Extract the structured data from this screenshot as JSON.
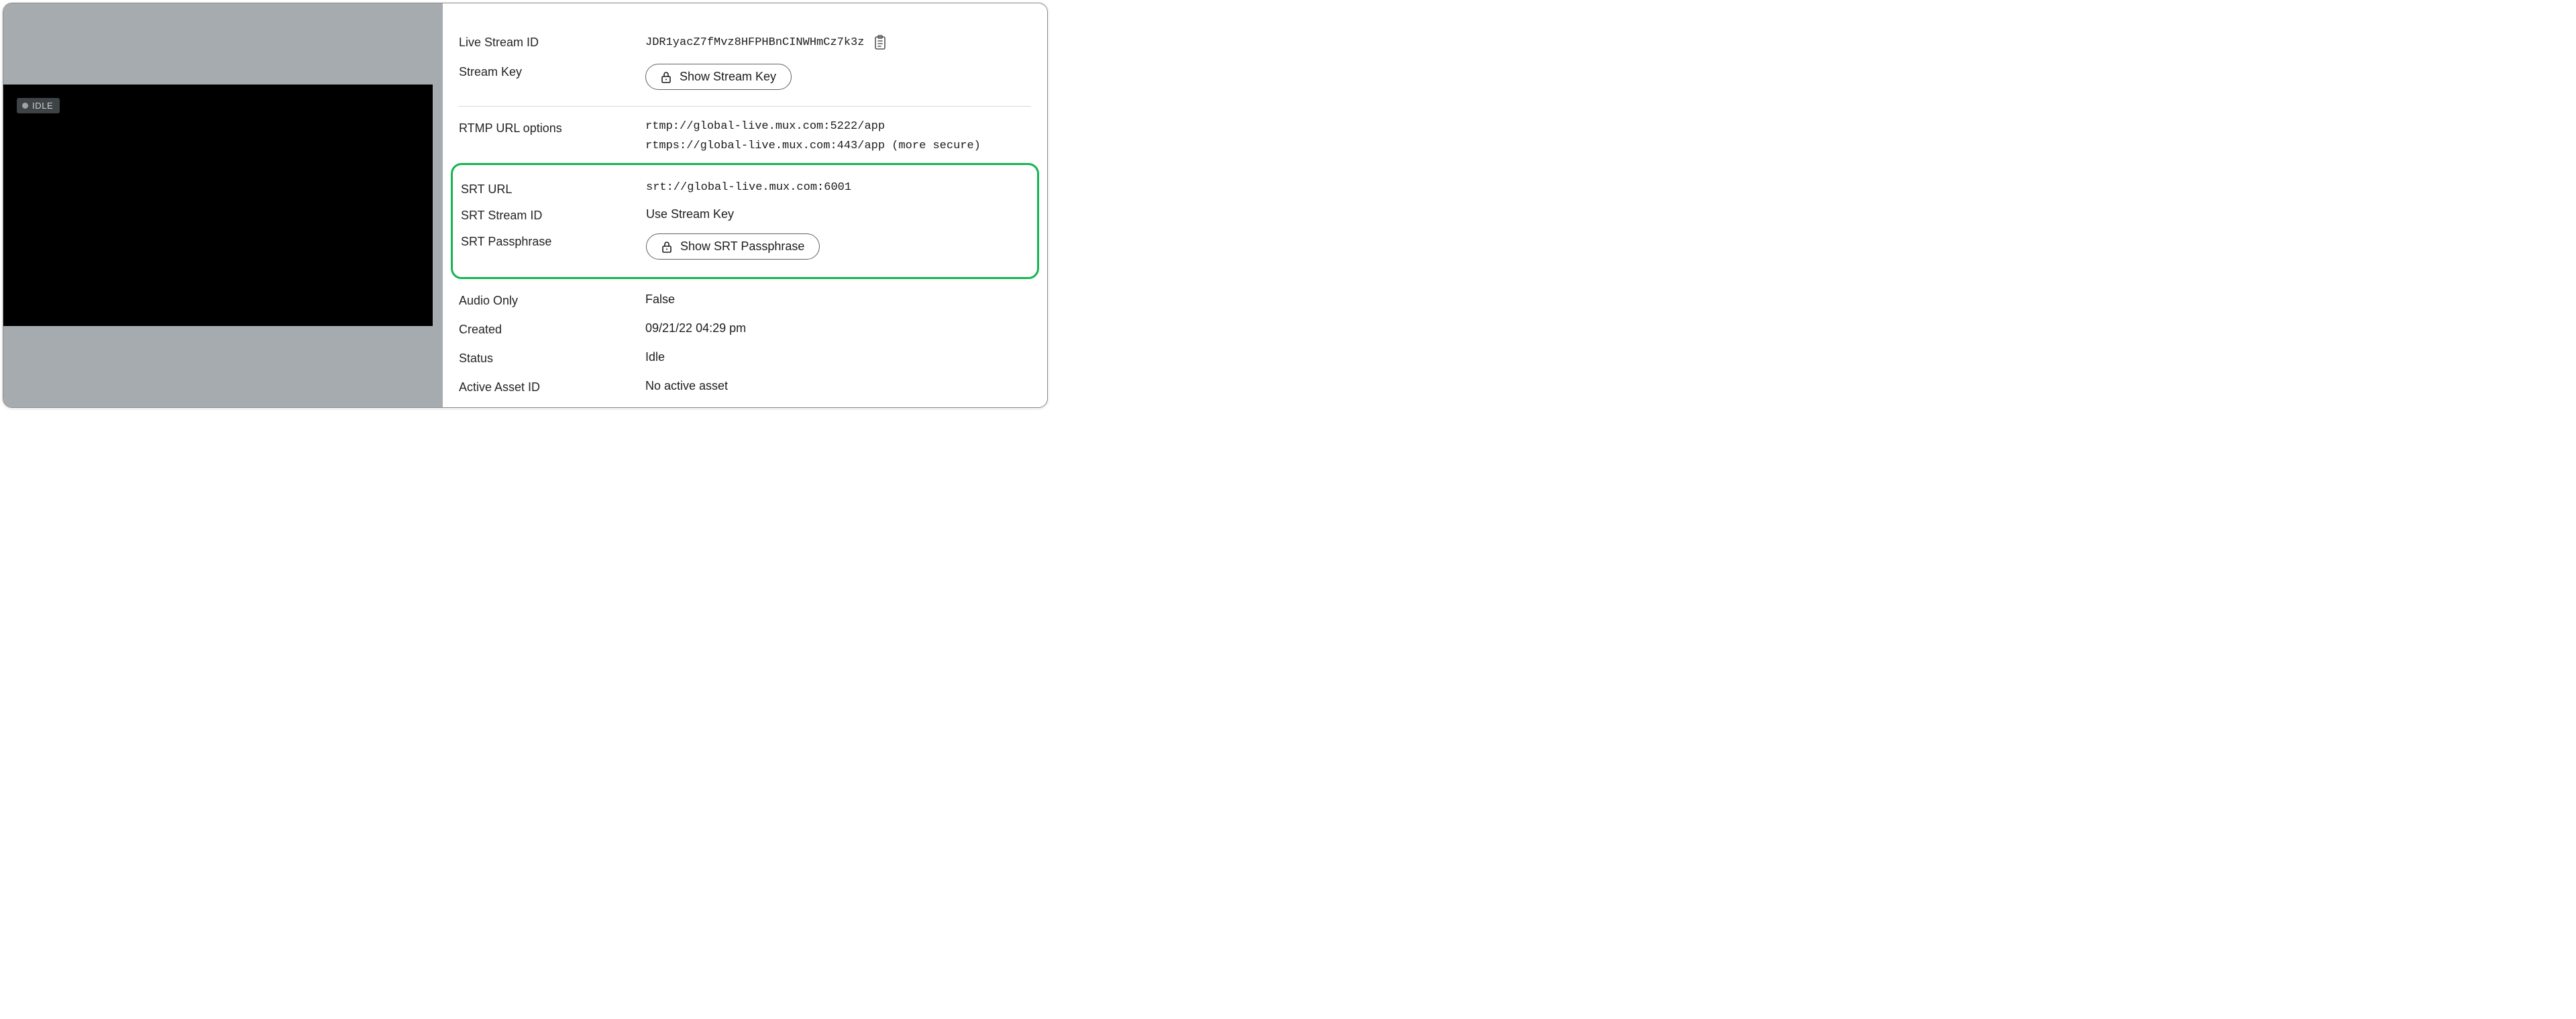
{
  "player": {
    "status_badge": "IDLE"
  },
  "labels": {
    "live_stream_id": "Live Stream ID",
    "stream_key": "Stream Key",
    "rtmp_url_options": "RTMP URL options",
    "srt_url": "SRT URL",
    "srt_stream_id": "SRT Stream ID",
    "srt_passphrase": "SRT Passphrase",
    "audio_only": "Audio Only",
    "created": "Created",
    "status": "Status",
    "active_asset_id": "Active Asset ID"
  },
  "values": {
    "live_stream_id": "JDR1yacZ7fMvz8HFPHBnCINWHmCz7k3z",
    "rtmp_url_1": "rtmp://global-live.mux.com:5222/app",
    "rtmp_url_2": "rtmps://global-live.mux.com:443/app (more secure)",
    "srt_url": "srt://global-live.mux.com:6001",
    "srt_stream_id": "Use Stream Key",
    "audio_only": "False",
    "created": "09/21/22 04:29 pm",
    "status": "Idle",
    "active_asset_id": "No active asset"
  },
  "buttons": {
    "show_stream_key": "Show Stream Key",
    "show_srt_passphrase": "Show SRT Passphrase"
  }
}
